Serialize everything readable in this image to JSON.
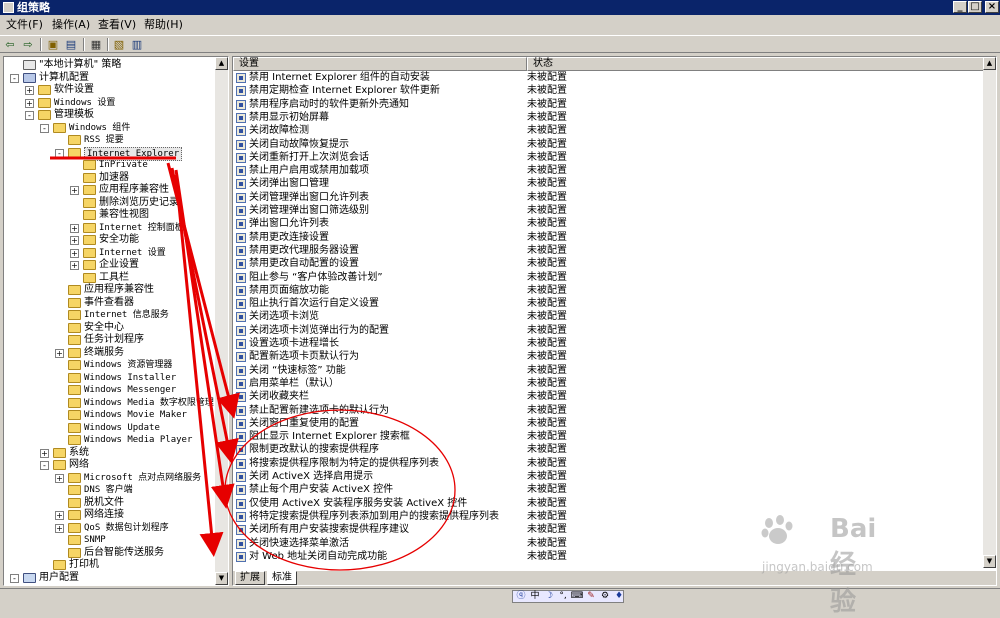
{
  "window": {
    "title": "组策略",
    "buttons": [
      "_",
      "□",
      "×"
    ]
  },
  "menu": [
    "文件(F)",
    "操作(A)",
    "查看(V)",
    "帮助(H)"
  ],
  "toolbar_icons": [
    "back-icon",
    "forward-icon",
    "up-folder-icon",
    "show-tree-icon",
    "export-list-icon",
    "properties-icon",
    "help-icon"
  ],
  "tree": {
    "nodes": [
      {
        "label": "\"本地计算机\" 策略",
        "depth": 0,
        "exp": "",
        "icon": "policy"
      },
      {
        "label": "计算机配置",
        "depth": 0,
        "exp": "-",
        "icon": "computer"
      },
      {
        "label": "软件设置",
        "depth": 1,
        "exp": "+",
        "icon": "folder"
      },
      {
        "label": "Windows 设置",
        "depth": 1,
        "exp": "+",
        "icon": "folder"
      },
      {
        "label": "管理模板",
        "depth": 1,
        "exp": "-",
        "icon": "folder"
      },
      {
        "label": "Windows 组件",
        "depth": 2,
        "exp": "-",
        "icon": "folder"
      },
      {
        "label": "RSS 提要",
        "depth": 3,
        "exp": "",
        "icon": "folder"
      },
      {
        "label": "Internet Explorer",
        "depth": 3,
        "exp": "-",
        "icon": "folder"
      },
      {
        "label": "InPrivate",
        "depth": 4,
        "exp": "",
        "icon": "folder"
      },
      {
        "label": "加速器",
        "depth": 4,
        "exp": "",
        "icon": "folder"
      },
      {
        "label": "应用程序兼容性",
        "depth": 4,
        "exp": "+",
        "icon": "folder"
      },
      {
        "label": "删除浏览历史记录",
        "depth": 4,
        "exp": "",
        "icon": "folder"
      },
      {
        "label": "兼容性视图",
        "depth": 4,
        "exp": "",
        "icon": "folder"
      },
      {
        "label": "Internet 控制面板",
        "depth": 4,
        "exp": "+",
        "icon": "folder"
      },
      {
        "label": "安全功能",
        "depth": 4,
        "exp": "+",
        "icon": "folder"
      },
      {
        "label": "Internet 设置",
        "depth": 4,
        "exp": "+",
        "icon": "folder"
      },
      {
        "label": "企业设置",
        "depth": 4,
        "exp": "+",
        "icon": "folder"
      },
      {
        "label": "工具栏",
        "depth": 4,
        "exp": "",
        "icon": "folder"
      },
      {
        "label": "应用程序兼容性",
        "depth": 3,
        "exp": "",
        "icon": "folder"
      },
      {
        "label": "事件查看器",
        "depth": 3,
        "exp": "",
        "icon": "folder"
      },
      {
        "label": "Internet 信息服务",
        "depth": 3,
        "exp": "",
        "icon": "folder"
      },
      {
        "label": "安全中心",
        "depth": 3,
        "exp": "",
        "icon": "folder"
      },
      {
        "label": "任务计划程序",
        "depth": 3,
        "exp": "",
        "icon": "folder"
      },
      {
        "label": "终端服务",
        "depth": 3,
        "exp": "+",
        "icon": "folder"
      },
      {
        "label": "Windows 资源管理器",
        "depth": 3,
        "exp": "",
        "icon": "folder"
      },
      {
        "label": "Windows Installer",
        "depth": 3,
        "exp": "",
        "icon": "folder"
      },
      {
        "label": "Windows Messenger",
        "depth": 3,
        "exp": "",
        "icon": "folder"
      },
      {
        "label": "Windows Media 数字权限管理",
        "depth": 3,
        "exp": "",
        "icon": "folder"
      },
      {
        "label": "Windows Movie Maker",
        "depth": 3,
        "exp": "",
        "icon": "folder"
      },
      {
        "label": "Windows Update",
        "depth": 3,
        "exp": "",
        "icon": "folder"
      },
      {
        "label": "Windows Media Player",
        "depth": 3,
        "exp": "",
        "icon": "folder"
      },
      {
        "label": "系统",
        "depth": 2,
        "exp": "+",
        "icon": "folder"
      },
      {
        "label": "网络",
        "depth": 2,
        "exp": "-",
        "icon": "folder"
      },
      {
        "label": "Microsoft 点对点网络服务",
        "depth": 3,
        "exp": "+",
        "icon": "folder"
      },
      {
        "label": "DNS 客户端",
        "depth": 3,
        "exp": "",
        "icon": "folder"
      },
      {
        "label": "脱机文件",
        "depth": 3,
        "exp": "",
        "icon": "folder"
      },
      {
        "label": "网络连接",
        "depth": 3,
        "exp": "+",
        "icon": "folder"
      },
      {
        "label": "QoS 数据包计划程序",
        "depth": 3,
        "exp": "+",
        "icon": "folder"
      },
      {
        "label": "SNMP",
        "depth": 3,
        "exp": "",
        "icon": "folder"
      },
      {
        "label": "后台智能传送服务",
        "depth": 3,
        "exp": "",
        "icon": "folder"
      },
      {
        "label": "打印机",
        "depth": 2,
        "exp": "",
        "icon": "folder"
      },
      {
        "label": "用户配置",
        "depth": 0,
        "exp": "-",
        "icon": "user"
      }
    ]
  },
  "list": {
    "headers": [
      "设置",
      "状态"
    ],
    "rows": [
      {
        "setting": "禁用 Internet Explorer 组件的自动安装",
        "state": "未被配置"
      },
      {
        "setting": "禁用定期检查 Internet Explorer 软件更新",
        "state": "未被配置"
      },
      {
        "setting": "禁用程序启动时的软件更新外壳通知",
        "state": "未被配置"
      },
      {
        "setting": "禁用显示初始屏幕",
        "state": "未被配置"
      },
      {
        "setting": "关闭故障检测",
        "state": "未被配置"
      },
      {
        "setting": "关闭自动故障恢复提示",
        "state": "未被配置"
      },
      {
        "setting": "关闭重新打开上次浏览会话",
        "state": "未被配置"
      },
      {
        "setting": "禁止用户启用或禁用加载项",
        "state": "未被配置"
      },
      {
        "setting": "关闭弹出窗口管理",
        "state": "未被配置"
      },
      {
        "setting": "关闭管理弹出窗口允许列表",
        "state": "未被配置"
      },
      {
        "setting": "关闭管理弹出窗口筛选级别",
        "state": "未被配置"
      },
      {
        "setting": "弹出窗口允许列表",
        "state": "未被配置"
      },
      {
        "setting": "禁用更改连接设置",
        "state": "未被配置"
      },
      {
        "setting": "禁用更改代理服务器设置",
        "state": "未被配置"
      },
      {
        "setting": "禁用更改自动配置的设置",
        "state": "未被配置"
      },
      {
        "setting": "阻止参与 “客户体验改善计划”",
        "state": "未被配置"
      },
      {
        "setting": "禁用页面缩放功能",
        "state": "未被配置"
      },
      {
        "setting": "阻止执行首次运行自定义设置",
        "state": "未被配置"
      },
      {
        "setting": "关闭选项卡浏览",
        "state": "未被配置"
      },
      {
        "setting": "关闭选项卡浏览弹出行为的配置",
        "state": "未被配置"
      },
      {
        "setting": "设置选项卡进程增长",
        "state": "未被配置"
      },
      {
        "setting": "配置新选项卡页默认行为",
        "state": "未被配置"
      },
      {
        "setting": "关闭 “快速标签” 功能",
        "state": "未被配置"
      },
      {
        "setting": "启用菜单栏（默认）",
        "state": "未被配置"
      },
      {
        "setting": "关闭收藏夹栏",
        "state": "未被配置"
      },
      {
        "setting": "禁止配置新建选项卡的默认行为",
        "state": "未被配置"
      },
      {
        "setting": "关闭窗口重复使用的配置",
        "state": "未被配置"
      },
      {
        "setting": "阻止显示 Internet Explorer 搜索框",
        "state": "未被配置"
      },
      {
        "setting": "限制更改默认的搜索提供程序",
        "state": "未被配置"
      },
      {
        "setting": "将搜索提供程序限制为特定的提供程序列表",
        "state": "未被配置"
      },
      {
        "setting": "关闭 ActiveX 选择启用提示",
        "state": "未被配置"
      },
      {
        "setting": "禁止每个用户安装 ActiveX 控件",
        "state": "未被配置"
      },
      {
        "setting": "仅使用 ActiveX 安装程序服务安装 ActiveX 控件",
        "state": "未被配置"
      },
      {
        "setting": "将特定搜索提供程序列表添加到用户的搜索提供程序列表",
        "state": "未被配置"
      },
      {
        "setting": "关闭所有用户安装搜索提供程序建议",
        "state": "未被配置"
      },
      {
        "setting": "关闭快速选择菜单激活",
        "state": "未被配置"
      },
      {
        "setting": "对 Web 地址关闭自动完成功能",
        "state": "未被配置"
      }
    ]
  },
  "tabs": [
    "扩展",
    "标准"
  ],
  "ime": [
    "中",
    "☽",
    "°,",
    "⌨",
    "✎",
    "⚙",
    "♦"
  ],
  "watermark": {
    "text": "Bai 经验",
    "url": "jingyan.baidu.com"
  },
  "colors": {
    "titlebar": "#0a246a",
    "face": "#d4d0c8",
    "annotation": "#e60000"
  }
}
